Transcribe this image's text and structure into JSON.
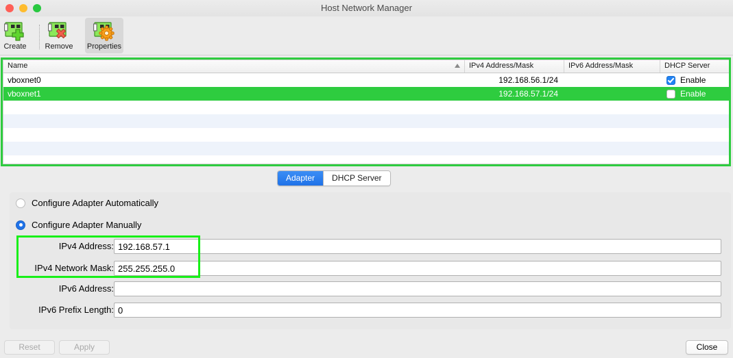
{
  "window": {
    "title": "Host Network Manager",
    "traffic_lights": [
      "close-red",
      "minimize-yellow",
      "maximize-green"
    ]
  },
  "toolbar": {
    "items": [
      {
        "label": "Create",
        "icon": "network-card-add-icon",
        "active": false
      },
      {
        "label": "Remove",
        "icon": "network-card-remove-icon",
        "active": false
      },
      {
        "label": "Properties",
        "icon": "network-card-gear-icon",
        "active": true
      }
    ]
  },
  "table": {
    "columns": [
      {
        "key": "name",
        "label": "Name",
        "sorted": true,
        "sort_dir": "asc"
      },
      {
        "key": "ipv4",
        "label": "IPv4 Address/Mask"
      },
      {
        "key": "ipv6",
        "label": "IPv6 Address/Mask"
      },
      {
        "key": "dhcp",
        "label": "DHCP Server"
      }
    ],
    "rows": [
      {
        "name": "vboxnet0",
        "ipv4": "192.168.56.1/24",
        "ipv6": "",
        "dhcp_label": "Enable",
        "dhcp_checked": true,
        "selected": false
      },
      {
        "name": "vboxnet1",
        "ipv4": "192.168.57.1/24",
        "ipv6": "",
        "dhcp_label": "Enable",
        "dhcp_checked": false,
        "selected": true
      }
    ],
    "empty_row_count": 5,
    "selection_color": "#2ecc3f",
    "stripe_color": "#eef3fb"
  },
  "tabs": [
    {
      "label": "Adapter",
      "selected": true
    },
    {
      "label": "DHCP Server",
      "selected": false
    }
  ],
  "adapter": {
    "radios": [
      {
        "label": "Configure Adapter Automatically",
        "selected": false
      },
      {
        "label": "Configure Adapter Manually",
        "selected": true
      }
    ],
    "fields": [
      {
        "label": "IPv4 Address:",
        "value": "192.168.57.1",
        "placeholder": ""
      },
      {
        "label": "IPv4 Network Mask:",
        "value": "255.255.255.0",
        "placeholder": ""
      },
      {
        "label": "IPv6 Address:",
        "value": "",
        "placeholder": ""
      },
      {
        "label": "IPv6 Prefix Length:",
        "value": "0",
        "placeholder": ""
      }
    ]
  },
  "footer": {
    "reset_label": "Reset",
    "apply_label": "Apply",
    "close_label": "Close",
    "reset_enabled": false,
    "apply_enabled": false
  },
  "annotations": {
    "highlight_color": "#18f018",
    "regions": [
      "host-network-table",
      "ipv4-address-fields"
    ]
  }
}
